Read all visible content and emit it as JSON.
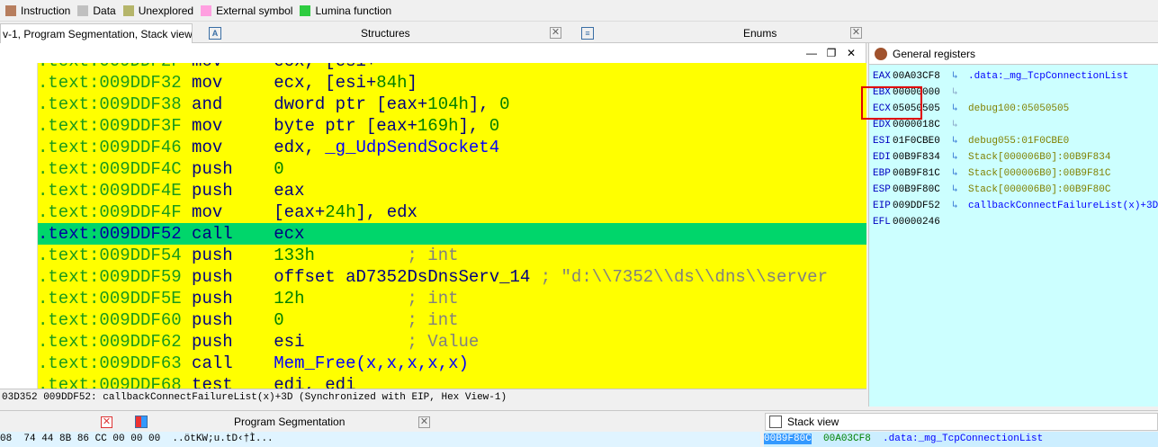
{
  "legend": [
    {
      "label": "Instruction",
      "color": "#b77e5e"
    },
    {
      "label": "Data",
      "color": "#c0c0c0"
    },
    {
      "label": "Unexplored",
      "color": "#b5b56a"
    },
    {
      "label": "External symbol",
      "color": "#ff9fe0"
    },
    {
      "label": "Lumina function",
      "color": "#2ecc40"
    }
  ],
  "tabs": {
    "ida_view": "v-1, Program Segmentation, Stack view",
    "structures": "Structures",
    "enums": "Enums"
  },
  "disasm": {
    "top_partial": ".text:009DDF2F mov     ecx, [esi+...]",
    "lines": [
      {
        "addr": ".text:009DDF32",
        "mnem": "mov",
        "ops": "ecx, [esi+",
        "num": "84h",
        "tail": "]"
      },
      {
        "addr": ".text:009DDF38",
        "mnem": "and",
        "ops": "dword ptr [eax+",
        "num": "104h",
        "tail": "], ",
        "num2": "0"
      },
      {
        "addr": ".text:009DDF3F",
        "mnem": "mov",
        "ops": "byte ptr [eax+",
        "num": "169h",
        "tail": "], ",
        "num2": "0"
      },
      {
        "addr": ".text:009DDF46",
        "mnem": "mov",
        "ops": "edx, ",
        "sym": "_g_UdpSendSocket4"
      },
      {
        "addr": ".text:009DDF4C",
        "mnem": "push",
        "ops": "",
        "num": "0"
      },
      {
        "addr": ".text:009DDF4E",
        "mnem": "push",
        "ops": "eax"
      },
      {
        "addr": ".text:009DDF4F",
        "mnem": "mov",
        "ops": "[eax+",
        "num": "24h",
        "tail": "], edx"
      },
      {
        "addr": ".text:009DDF52",
        "mnem": "call",
        "ops": "ecx",
        "highlight": true
      },
      {
        "addr": ".text:009DDF54",
        "mnem": "push",
        "ops": "",
        "num": "133h",
        "cmt": "         ; int"
      },
      {
        "addr": ".text:009DDF59",
        "mnem": "push",
        "ops": "offset aD7352DsDnsServ_14",
        "cmt": " ; \"d:\\\\7352\\\\ds\\\\dns\\\\server"
      },
      {
        "addr": ".text:009DDF5E",
        "mnem": "push",
        "ops": "",
        "num": "12h",
        "cmt": "          ; int"
      },
      {
        "addr": ".text:009DDF60",
        "mnem": "push",
        "ops": "",
        "num": "0",
        "cmt": "            ; int"
      },
      {
        "addr": ".text:009DDF62",
        "mnem": "push",
        "ops": "esi",
        "cmt": "          ; Value"
      },
      {
        "addr": ".text:009DDF63",
        "mnem": "call",
        "sym": "Mem_Free(x,x,x,x,x)"
      },
      {
        "addr": ".text:009DDF68",
        "mnem": "test",
        "ops": "edi, edi"
      }
    ],
    "status": "03D352 009DDF52: callbackConnectFailureList(x)+3D (Synchronized with EIP, Hex View-1)"
  },
  "registers": {
    "title": "General registers",
    "rows": [
      {
        "name": "EAX",
        "value": "00A03CF8",
        "target": ".data:_mg_TcpConnectionList",
        "kind": "sym"
      },
      {
        "name": "EBX",
        "value": "00000000",
        "target": "",
        "kind": "dim"
      },
      {
        "name": "ECX",
        "value": "05050505",
        "target": "debug100:05050505",
        "kind": "dbg"
      },
      {
        "name": "EDX",
        "value": "0000018C",
        "target": "",
        "kind": "dim"
      },
      {
        "name": "ESI",
        "value": "01F0CBE0",
        "target": "debug055:01F0CBE0",
        "kind": "dbg"
      },
      {
        "name": "EDI",
        "value": "00B9F834",
        "target": "Stack[000006B0]:00B9F834",
        "kind": "dbg"
      },
      {
        "name": "EBP",
        "value": "00B9F81C",
        "target": "Stack[000006B0]:00B9F81C",
        "kind": "dbg"
      },
      {
        "name": "ESP",
        "value": "00B9F80C",
        "target": "Stack[000006B0]:00B9F80C",
        "kind": "dbg"
      },
      {
        "name": "EIP",
        "value": "009DDF52",
        "target": "callbackConnectFailureList(x)+3D",
        "kind": "sym"
      },
      {
        "name": "EFL",
        "value": "00000246",
        "target": "",
        "kind": "none"
      }
    ]
  },
  "bottom": {
    "hex_tab": "",
    "program_segmentation": "Program Segmentation",
    "stack_view": "Stack view",
    "hex_line": "08  74 44 8B 86 CC 00 00 00  ..ötKW;u.tD‹†Ì...",
    "stack_addr": "00B9F80C",
    "stack_val": "00A03CF8",
    "stack_sym": ".data:_mg_TcpConnectionList"
  }
}
